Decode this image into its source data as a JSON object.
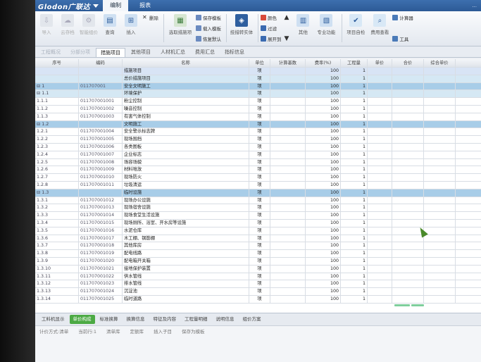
{
  "title_bar": {
    "logo": "Glodon广联达",
    "tabs": [
      "编制",
      "报表"
    ],
    "right_text": "..."
  },
  "ribbon": {
    "buttons": [
      {
        "label": "导入",
        "icon": "import-icon"
      },
      {
        "label": "云存档",
        "icon": "cloud-icon"
      },
      {
        "label": "智能组价",
        "icon": "smart-price-icon"
      },
      {
        "label": "查询",
        "icon": "query-icon"
      },
      {
        "label": "插入",
        "icon": "insert-icon"
      },
      {
        "label": "删除",
        "icon": "delete-icon"
      },
      {
        "label": "选取措施项",
        "icon": "select-measure-icon"
      },
      {
        "label": "保存模板",
        "icon": "save-template-icon"
      },
      {
        "label": "载入模板",
        "icon": "load-template-icon"
      },
      {
        "label": "恢复默认",
        "icon": "restore-icon"
      },
      {
        "label": "技措转实体",
        "icon": "convert-icon"
      },
      {
        "label": "颜色",
        "icon": "color-icon"
      },
      {
        "label": "过滤",
        "icon": "filter-icon"
      },
      {
        "label": "展开到",
        "icon": "expand-icon"
      },
      {
        "label": "其他",
        "icon": "other-icon"
      },
      {
        "label": "专业功能",
        "icon": "professional-icon"
      },
      {
        "label": "项目自检",
        "icon": "check-icon"
      },
      {
        "label": "费用查看",
        "icon": "cost-view-icon"
      },
      {
        "label": "计算器",
        "icon": "calculator-icon"
      },
      {
        "label": "工具",
        "icon": "tools-icon"
      }
    ]
  },
  "sub_tabs": [
    "工程概况",
    "分部分项",
    "措施项目",
    "其他项目",
    "人材机汇总",
    "费用汇总",
    "指标信息"
  ],
  "sub_tab_active": 2,
  "grid": {
    "headers": [
      "序号",
      "编码",
      "名称",
      "单位",
      "计算基数",
      "费率(%)",
      "工程量",
      "单价",
      "合价",
      "综合单价"
    ],
    "rows": [
      {
        "n": "",
        "code": "",
        "name": "措施项目",
        "unit": "项",
        "rate": "100",
        "qty": "1",
        "style": "sel"
      },
      {
        "n": "",
        "code": "",
        "name": "总价措施项目",
        "unit": "项",
        "rate": "100",
        "qty": "1",
        "style": "lvl2"
      },
      {
        "n": "⊟ 1",
        "code": "011707001",
        "name": "安全文明施工",
        "unit": "项",
        "rate": "100",
        "qty": "1",
        "style": "grp"
      },
      {
        "n": "⊟ 1.1",
        "code": "",
        "name": "环境保护",
        "unit": "项",
        "rate": "100",
        "qty": "1",
        "style": "lvl2"
      },
      {
        "n": "1.1.1",
        "code": "011707001001",
        "name": "粉尘控制",
        "unit": "项",
        "rate": "100",
        "qty": "1",
        "style": ""
      },
      {
        "n": "1.1.2",
        "code": "011707001002",
        "name": "噪音控制",
        "unit": "项",
        "rate": "100",
        "qty": "1",
        "style": ""
      },
      {
        "n": "1.1.3",
        "code": "011707001003",
        "name": "有害气体控制",
        "unit": "项",
        "rate": "100",
        "qty": "1",
        "style": ""
      },
      {
        "n": "⊟ 1.2",
        "code": "",
        "name": "文明施工",
        "unit": "项",
        "rate": "100",
        "qty": "1",
        "style": "grp"
      },
      {
        "n": "1.2.1",
        "code": "011707001004",
        "name": "安全警示标志牌",
        "unit": "项",
        "rate": "100",
        "qty": "1",
        "style": ""
      },
      {
        "n": "1.2.2",
        "code": "011707001005",
        "name": "现场围挡",
        "unit": "项",
        "rate": "100",
        "qty": "1",
        "style": ""
      },
      {
        "n": "1.2.3",
        "code": "011707001006",
        "name": "各类图板",
        "unit": "项",
        "rate": "100",
        "qty": "1",
        "style": ""
      },
      {
        "n": "1.2.4",
        "code": "011707001007",
        "name": "企业标志",
        "unit": "项",
        "rate": "100",
        "qty": "1",
        "style": ""
      },
      {
        "n": "1.2.5",
        "code": "011707001008",
        "name": "场容场貌",
        "unit": "项",
        "rate": "100",
        "qty": "1",
        "style": ""
      },
      {
        "n": "1.2.6",
        "code": "011707001009",
        "name": "材料堆放",
        "unit": "项",
        "rate": "100",
        "qty": "1",
        "style": ""
      },
      {
        "n": "1.2.7",
        "code": "011707001010",
        "name": "现场防火",
        "unit": "项",
        "rate": "100",
        "qty": "1",
        "style": ""
      },
      {
        "n": "1.2.8",
        "code": "011707001011",
        "name": "垃圾清运",
        "unit": "项",
        "rate": "100",
        "qty": "1",
        "style": ""
      },
      {
        "n": "⊟ 1.3",
        "code": "",
        "name": "临时设施",
        "unit": "项",
        "rate": "100",
        "qty": "1",
        "style": "grp"
      },
      {
        "n": "1.3.1",
        "code": "011707001012",
        "name": "现场办公设施",
        "unit": "项",
        "rate": "100",
        "qty": "1",
        "style": ""
      },
      {
        "n": "1.3.2",
        "code": "011707001013",
        "name": "现场宿舍设施",
        "unit": "项",
        "rate": "100",
        "qty": "1",
        "style": ""
      },
      {
        "n": "1.3.3",
        "code": "011707001014",
        "name": "现场食堂生活设施",
        "unit": "项",
        "rate": "100",
        "qty": "1",
        "style": ""
      },
      {
        "n": "1.3.4",
        "code": "011707001015",
        "name": "现场厕所、浴室、开水房等设施",
        "unit": "项",
        "rate": "100",
        "qty": "1",
        "style": ""
      },
      {
        "n": "1.3.5",
        "code": "011707001016",
        "name": "水泥仓库",
        "unit": "项",
        "rate": "100",
        "qty": "1",
        "style": ""
      },
      {
        "n": "1.3.6",
        "code": "011707001017",
        "name": "木工棚、钢筋棚",
        "unit": "项",
        "rate": "100",
        "qty": "1",
        "style": ""
      },
      {
        "n": "1.3.7",
        "code": "011707001018",
        "name": "其他库房",
        "unit": "项",
        "rate": "100",
        "qty": "1",
        "style": ""
      },
      {
        "n": "1.3.8",
        "code": "011707001019",
        "name": "配电线路",
        "unit": "项",
        "rate": "100",
        "qty": "1",
        "style": ""
      },
      {
        "n": "1.3.9",
        "code": "011707001020",
        "name": "配电箱开关箱",
        "unit": "项",
        "rate": "100",
        "qty": "1",
        "style": ""
      },
      {
        "n": "1.3.10",
        "code": "011707001021",
        "name": "接地保护装置",
        "unit": "项",
        "rate": "100",
        "qty": "1",
        "style": ""
      },
      {
        "n": "1.3.11",
        "code": "011707001022",
        "name": "供水管线",
        "unit": "项",
        "rate": "100",
        "qty": "1",
        "style": ""
      },
      {
        "n": "1.3.12",
        "code": "011707001023",
        "name": "排水管线",
        "unit": "项",
        "rate": "100",
        "qty": "1",
        "style": ""
      },
      {
        "n": "1.3.13",
        "code": "011707001024",
        "name": "沉淀池",
        "unit": "项",
        "rate": "100",
        "qty": "1",
        "style": ""
      },
      {
        "n": "1.3.14",
        "code": "011707001025",
        "name": "临时道路",
        "unit": "项",
        "rate": "100",
        "qty": "1",
        "style": ""
      }
    ]
  },
  "bottom_tabs": [
    "工料机显示",
    "单价构成",
    "标准换算",
    "换算信息",
    "特征及内容",
    "工程量明细",
    "说明信息",
    "组价方案"
  ],
  "bottom_tab_active": 1,
  "status": {
    "items": [
      "计价方式:清单",
      "当前行:1",
      "清单库",
      "定额库",
      "插入子目",
      "保存为模板"
    ]
  },
  "colors": {
    "titlebar": "#2c5a96",
    "group_row": "#a8cde8",
    "level2_row": "#d5e8f4",
    "active_bottom_tab": "#4caa44"
  }
}
